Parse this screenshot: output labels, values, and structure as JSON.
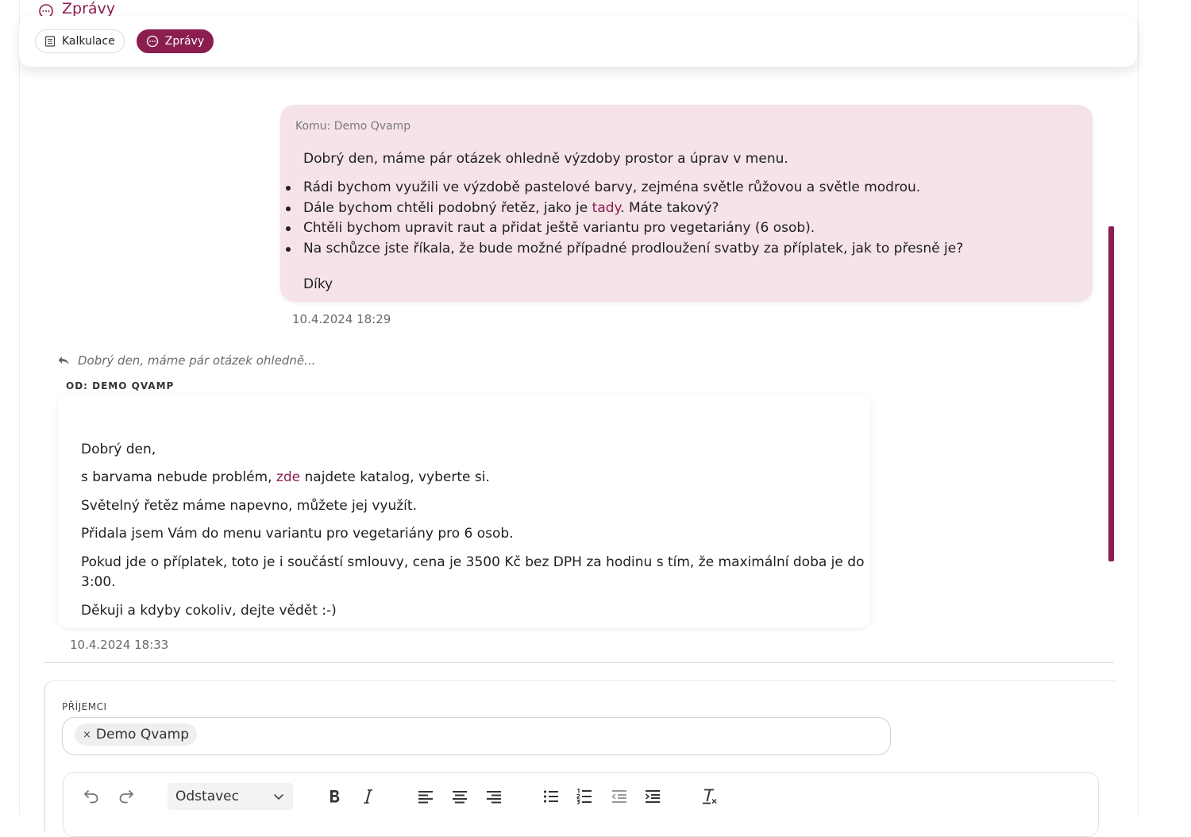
{
  "section": {
    "title": "Zprávy"
  },
  "tabs": [
    {
      "label": "Kalkulace",
      "icon": "document-list-icon",
      "active": false
    },
    {
      "label": "Zprávy",
      "icon": "chat-bubble-icon",
      "active": true
    }
  ],
  "colors": {
    "accent": "#8b1e4f",
    "sent_bubble": "#f5e3e8"
  },
  "sent_message": {
    "to": "Komu: Demo Qvamp",
    "greeting": "Dobrý den, máme pár otázek ohledně výzdoby prostor a úprav v menu.",
    "bullets": [
      "Rádi bychom využili ve výzdobě pastelové barvy, zejména světle růžovou a světle modrou.",
      "Dále bychom chtěli podobný řetěz, jako je",
      "Chtěli bychom upravit raut a přidat ještě variantu pro vegetariány (6 osob).",
      "Na schůzce jste říkala, že bude možné případné prodloužení svatby za příplatek, jak to přesně je?"
    ],
    "bullet2_link": "tady",
    "bullet2_suffix": ". Máte takový?",
    "closing": "Díky",
    "time": "10.4.2024 18:29"
  },
  "received_message": {
    "reply_ref": "Dobrý den, máme pár otázek ohledně...",
    "from": "OD: DEMO QVAMP",
    "greeting": "Dobrý den,",
    "p1_prefix": "s barvama nebude problém,",
    "p1_link": "zde",
    "p1_suffix": "najdete katalog, vyberte si.",
    "p2": "Světelný řetěz máme napevno, můžete jej využít.",
    "p3": "Přidala jsem Vám do menu variantu pro vegetariány pro 6 osob.",
    "p4_line1": "Pokud jde o příplatek, toto je i součástí smlouvy, cena je 3500 Kč bez DPH za hodinu s tím, že maximální doba je do",
    "p4_line2": "3:00.",
    "p5": "Děkuji a kdyby cokoliv, dejte vědět :-)",
    "time": "10.4.2024 18:33"
  },
  "compose": {
    "recipients_label": "PŘÍJEMCI",
    "recipient_chip": "Demo Qvamp",
    "chip_remove": "×",
    "block_format": "Odstavec",
    "toolbar_icons": [
      "undo-icon",
      "redo-icon",
      "bold-icon",
      "italic-icon",
      "align-left-icon",
      "align-center-icon",
      "align-right-icon",
      "bullet-list-icon",
      "numbered-list-icon",
      "outdent-icon",
      "indent-icon",
      "clear-format-icon"
    ]
  }
}
